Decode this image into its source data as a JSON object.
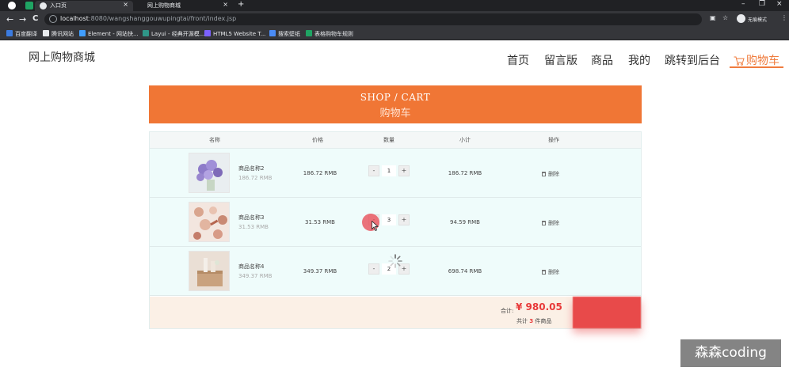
{
  "browser": {
    "tabs": [
      {
        "label": "入口页",
        "close": "×"
      },
      {
        "label": "网上购物商城",
        "close": "×"
      }
    ],
    "new_tab": "+",
    "window_controls": {
      "minimize": "–",
      "maximize": "❐",
      "close": "×"
    },
    "nav": {
      "back": "←",
      "forward": "→",
      "reload": "C"
    },
    "url_host": "localhost",
    "url_rest": ":8080/wangshanggouwupingtai/front/index.jsp",
    "incognito_label": "无痕模式",
    "menu_glyph": "⋮",
    "bookmarks": [
      {
        "label": "百度翻译",
        "color": "#3b7be0"
      },
      {
        "label": "腾讯网站",
        "color": "#e8eaed"
      },
      {
        "label": "Element - 网站快...",
        "color": "#409eff"
      },
      {
        "label": "Layui - 经典开源模...",
        "color": "#2f9688"
      },
      {
        "label": "HTML5 Website T...",
        "color": "#7b61ff"
      },
      {
        "label": "搜索壁纸",
        "color": "#4a8cf7"
      },
      {
        "label": "表格购物车规则",
        "color": "#1fa463"
      }
    ]
  },
  "site": {
    "logo": "网上购物商城",
    "nav": [
      {
        "label": "首页"
      },
      {
        "label": "留言版"
      },
      {
        "label": "商品"
      },
      {
        "label": "我的"
      },
      {
        "label": "跳转到后台"
      },
      {
        "label": "购物车"
      }
    ],
    "accent": "#f07635"
  },
  "banner": {
    "title_en": "SHOP / CART",
    "title_cn": "购物车"
  },
  "table": {
    "headers": [
      "名称",
      "价格",
      "数量",
      "小计",
      "操作"
    ],
    "rows": [
      {
        "name": "商品名称2",
        "unit_price_sub": "186.72 RMB",
        "price": "186.72 RMB",
        "minus": "-",
        "qty": "1",
        "plus": "+",
        "subtotal": "186.72 RMB",
        "action": "删除"
      },
      {
        "name": "商品名称3",
        "unit_price_sub": "31.53 RMB",
        "price": "31.53 RMB",
        "minus": "-",
        "qty": "3",
        "plus": "+",
        "subtotal": "94.59 RMB",
        "action": "删除"
      },
      {
        "name": "商品名称4",
        "unit_price_sub": "349.37 RMB",
        "price": "349.37 RMB",
        "minus": "-",
        "qty": "2",
        "plus": "+",
        "subtotal": "698.74 RMB",
        "action": "删除"
      }
    ],
    "footer": {
      "total_label": "合计:",
      "total_value": "¥ 980.05",
      "count_prefix": "共计",
      "count": "3",
      "count_suffix": "件商品"
    }
  },
  "watermark": "森森coding"
}
